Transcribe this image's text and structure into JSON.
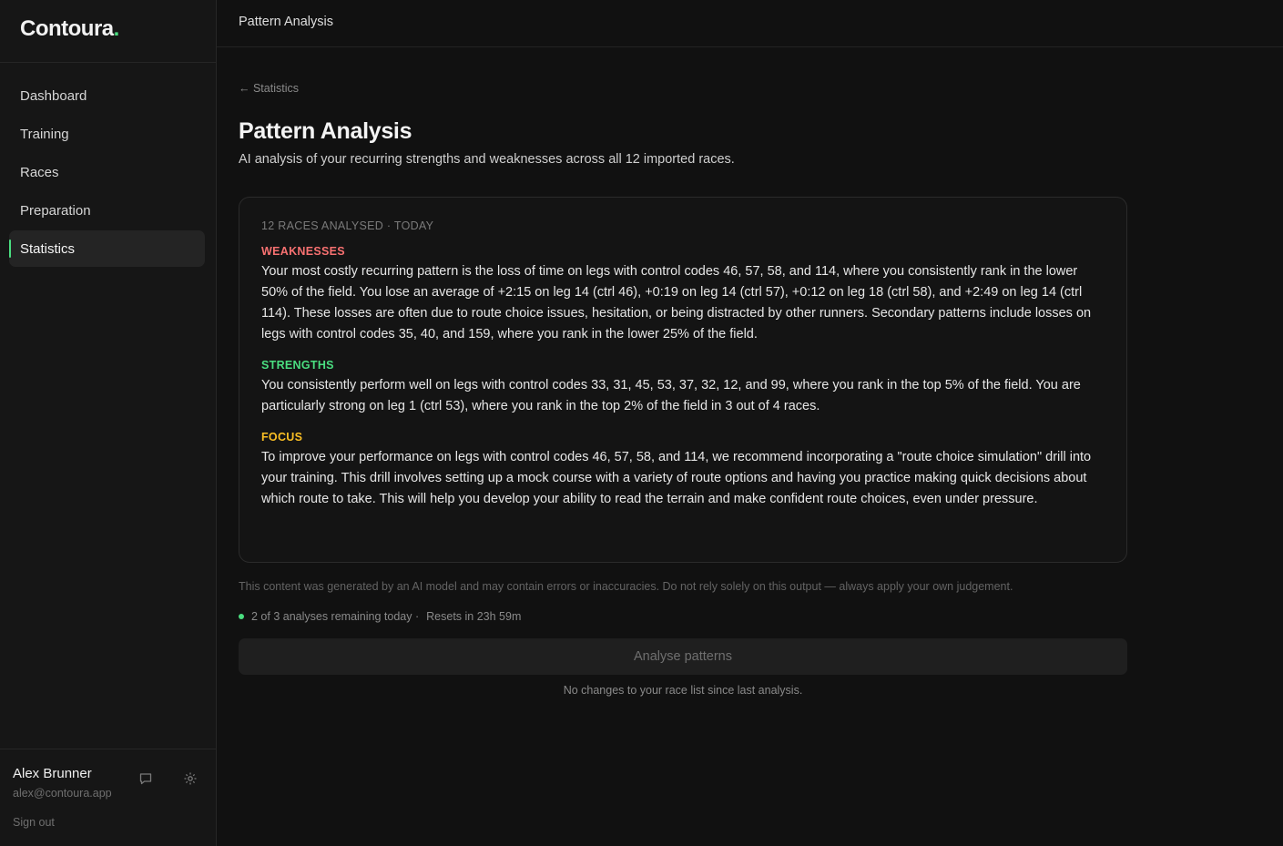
{
  "brand": {
    "name": "Contoura",
    "dot": "."
  },
  "nav": {
    "items": [
      {
        "label": "Dashboard",
        "active": false
      },
      {
        "label": "Training",
        "active": false
      },
      {
        "label": "Races",
        "active": false
      },
      {
        "label": "Preparation",
        "active": false
      },
      {
        "label": "Statistics",
        "active": true
      }
    ]
  },
  "user": {
    "name": "Alex Brunner",
    "email": "alex@contoura.app",
    "sign_out": "Sign out",
    "icons": [
      "chat-icon",
      "gear-icon"
    ]
  },
  "topbar": {
    "title": "Pattern Analysis"
  },
  "page": {
    "back_link": "← Statistics",
    "title": "Pattern Analysis",
    "subtitle": "AI analysis of your recurring strengths and weaknesses across all 12 imported races."
  },
  "analysis": {
    "meta": "12 RACES ANALYSED · TODAY",
    "weaknesses": {
      "label": "WEAKNESSES",
      "text": "Your most costly recurring pattern is the loss of time on legs with control codes 46, 57, 58, and 114, where you consistently rank in the lower 50% of the field. You lose an average of +2:15 on leg 14 (ctrl 46), +0:19 on leg 14 (ctrl 57), +0:12 on leg 18 (ctrl 58), and +2:49 on leg 14 (ctrl 114). These losses are often due to route choice issues, hesitation, or being distracted by other runners. Secondary patterns include losses on legs with control codes 35, 40, and 159, where you rank in the lower 25% of the field."
    },
    "strengths": {
      "label": "STRENGTHS",
      "text": "You consistently perform well on legs with control codes 33, 31, 45, 53, 37, 32, 12, and 99, where you rank in the top 5% of the field. You are particularly strong on leg 1 (ctrl 53), where you rank in the top 2% of the field in 3 out of 4 races."
    },
    "focus": {
      "label": "FOCUS",
      "text": "To improve your performance on legs with control codes 46, 57, 58, and 114, we recommend incorporating a \"route choice simulation\" drill into your training. This drill involves setting up a mock course with a variety of route options and having you practice making quick decisions about which route to take. This will help you develop your ability to read the terrain and make confident route choices, even under pressure."
    }
  },
  "disclaimer": "This content was generated by an AI model and may contain errors or inaccuracies. Do not rely solely on this output — always apply your own judgement.",
  "quota": {
    "remaining": "2 of 3 analyses remaining today ·",
    "resets": "Resets in 23h 59m"
  },
  "actions": {
    "analyse_label": "Analyse patterns",
    "no_changes": "No changes to your race list since last analysis."
  },
  "colors": {
    "accent": "#4ade80",
    "weakness": "#f87171",
    "strength": "#4ade80",
    "focus": "#fbbf24"
  }
}
